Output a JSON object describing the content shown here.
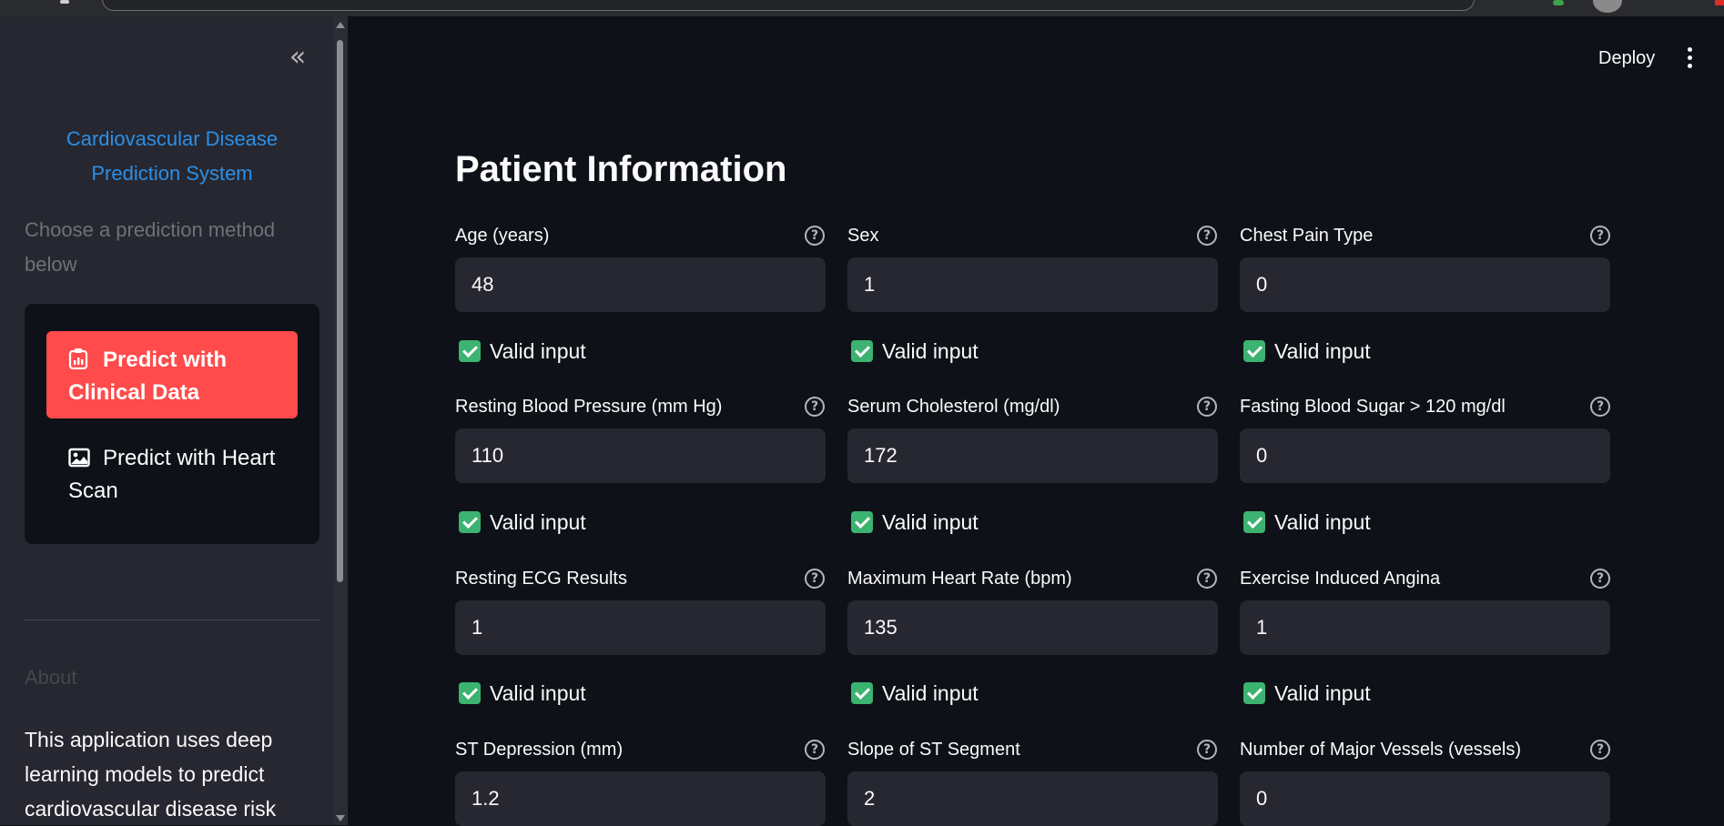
{
  "sidebar": {
    "collapse_icon": "chevrons-left-icon",
    "title": "Cardiovascular Disease Prediction System",
    "subtitle": "Choose a prediction method below",
    "methods": [
      {
        "label": "Predict with Clinical Data",
        "icon": "clipboard-icon",
        "active": true
      },
      {
        "label": "Predict with Heart Scan",
        "icon": "image-icon",
        "active": false
      }
    ],
    "about_label": "About",
    "about_text": "This application uses deep learning models to predict cardiovascular disease risk"
  },
  "header": {
    "deploy_label": "Deploy",
    "menu_icon": "kebab-menu-icon"
  },
  "main": {
    "title": "Patient Information",
    "valid_text": "Valid input",
    "fields": [
      {
        "label": "Age (years)",
        "value": "48",
        "valid": true
      },
      {
        "label": "Sex",
        "value": "1",
        "valid": true
      },
      {
        "label": "Chest Pain Type",
        "value": "0",
        "valid": true
      },
      {
        "label": "Resting Blood Pressure (mm Hg)",
        "value": "110",
        "valid": true
      },
      {
        "label": "Serum Cholesterol (mg/dl)",
        "value": "172",
        "valid": true
      },
      {
        "label": "Fasting Blood Sugar > 120 mg/dl",
        "value": "0",
        "valid": true
      },
      {
        "label": "Resting ECG Results",
        "value": "1",
        "valid": true
      },
      {
        "label": "Maximum Heart Rate (bpm)",
        "value": "135",
        "valid": true
      },
      {
        "label": "Exercise Induced Angina",
        "value": "1",
        "valid": true
      },
      {
        "label": "ST Depression (mm)",
        "value": "1.2",
        "valid": false
      },
      {
        "label": "Slope of ST Segment",
        "value": "2",
        "valid": false
      },
      {
        "label": "Number of Major Vessels (vessels)",
        "value": "0",
        "valid": false
      }
    ]
  },
  "colors": {
    "accent": "#ff4b4b",
    "link": "#2c8fe6",
    "background": "#0e1117",
    "sidebar_bg": "#262730",
    "input_bg": "#262730",
    "valid": "#3cb371"
  }
}
